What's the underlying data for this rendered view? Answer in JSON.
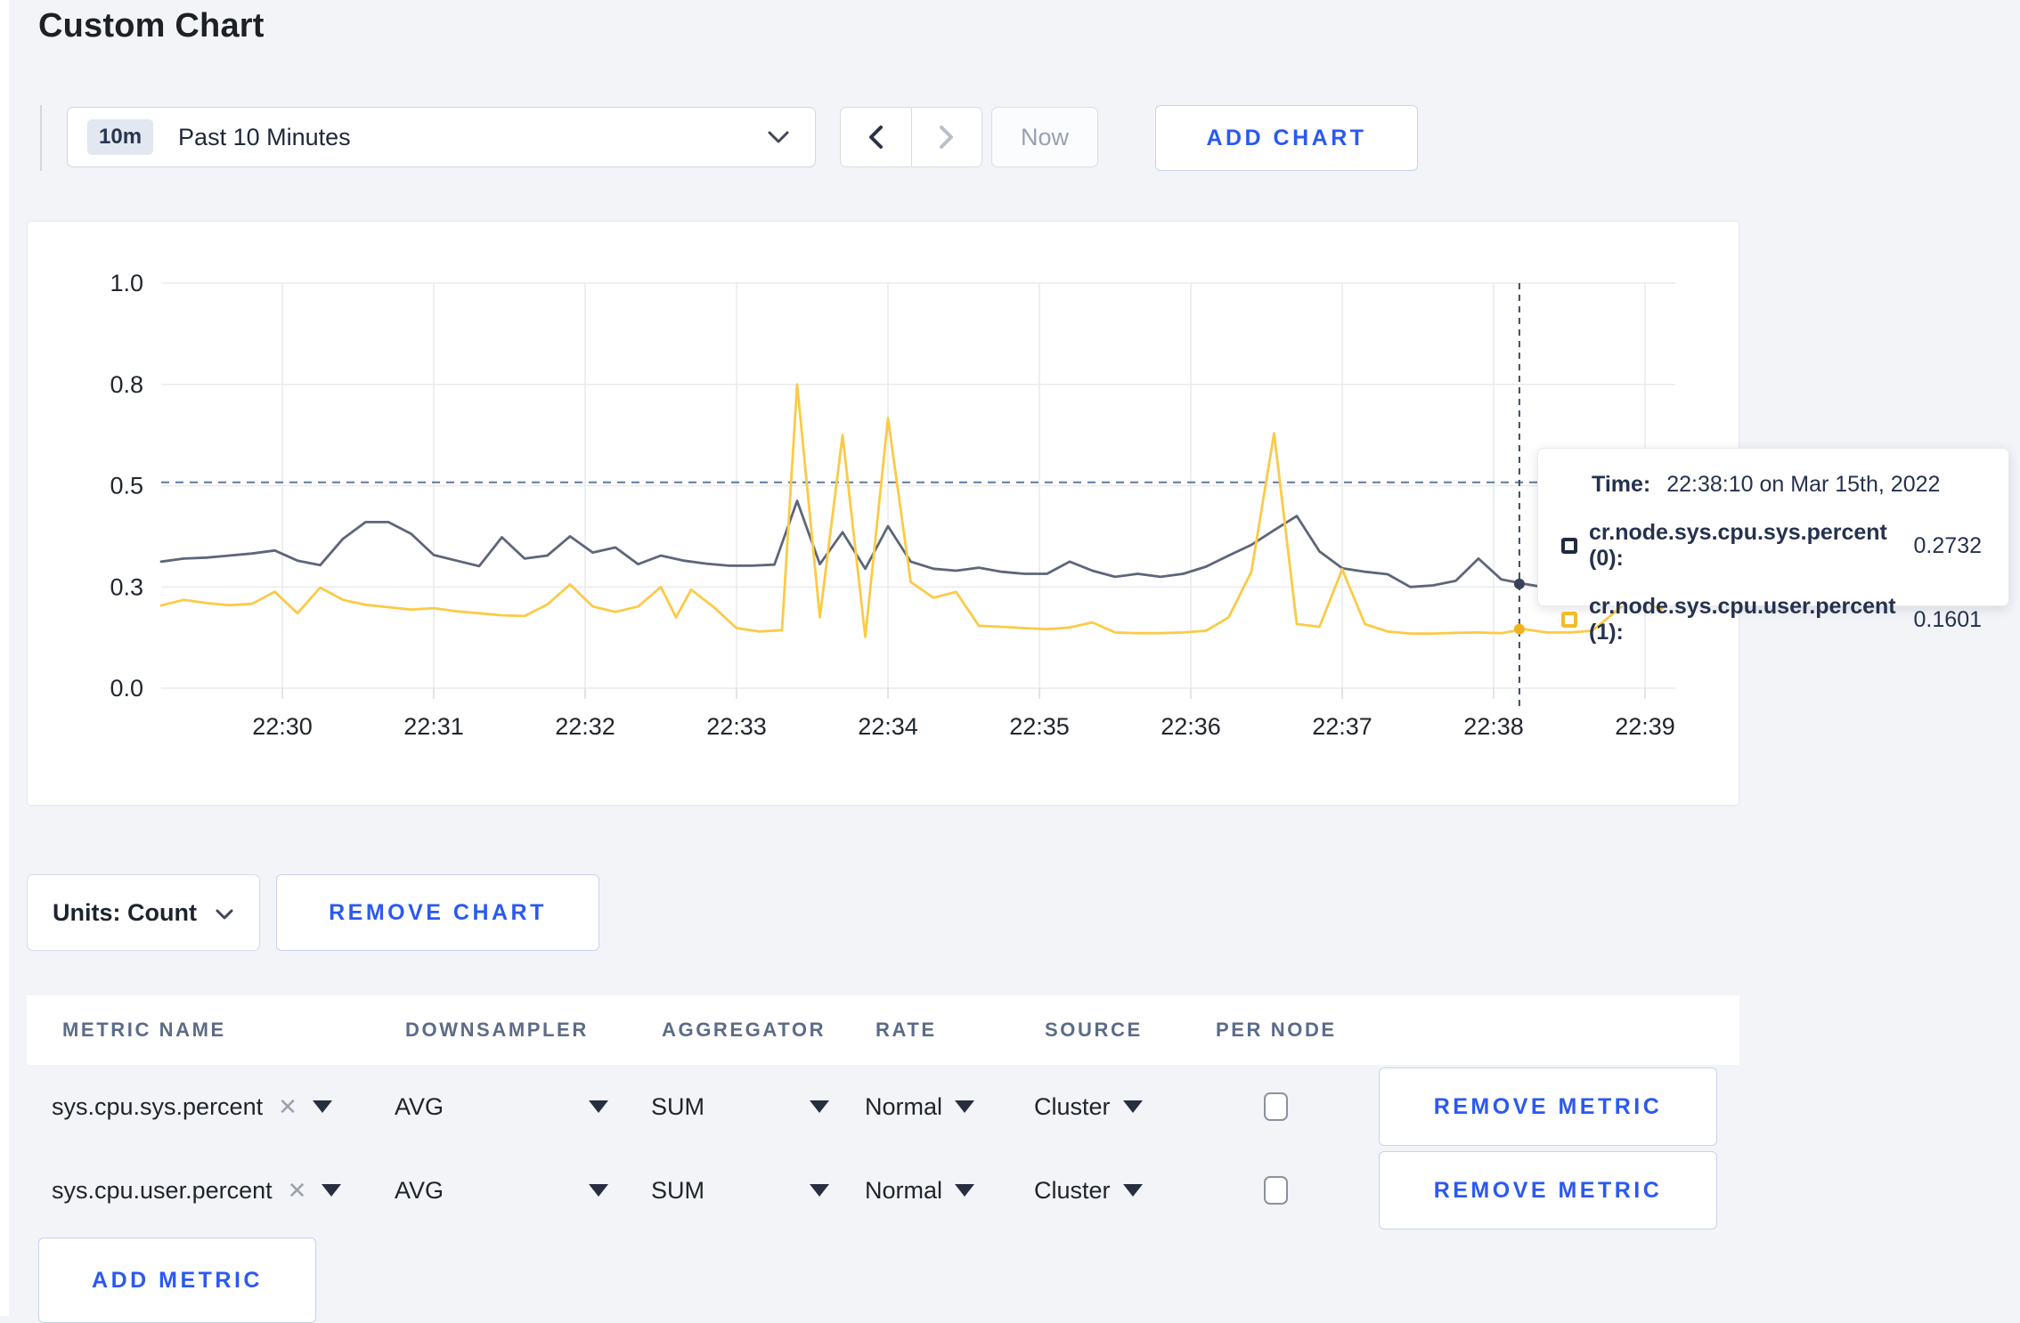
{
  "page": {
    "title": "Custom Chart"
  },
  "toolbar": {
    "time_range": {
      "badge": "10m",
      "label": "Past 10 Minutes"
    },
    "now_label": "Now",
    "add_chart_label": "ADD CHART"
  },
  "icons": {
    "time_dropdown": "chevron-down",
    "prev": "chevron-left",
    "next": "chevron-right",
    "units_dropdown": "chevron-down",
    "metric_remove": "x",
    "select_caret": "triangle-down"
  },
  "tooltip": {
    "time_label": "Time:",
    "time_value": "22:38:10 on Mar 15th, 2022",
    "series": [
      {
        "label": "cr.node.sys.cpu.sys.percent (0):",
        "value": "0.2732",
        "swatch_color": "#1f2940"
      },
      {
        "label": "cr.node.sys.cpu.user.percent (1):",
        "value": "0.1601",
        "swatch_color": "#f1bb2a"
      }
    ]
  },
  "chart_controls": {
    "units_label": "Units: Count",
    "remove_chart_label": "REMOVE CHART"
  },
  "metrics_table": {
    "headers": [
      "METRIC NAME",
      "DOWNSAMPLER",
      "AGGREGATOR",
      "RATE",
      "SOURCE",
      "PER NODE"
    ],
    "rows": [
      {
        "metric_name": "sys.cpu.sys.percent",
        "downsampler": "AVG",
        "aggregator": "SUM",
        "rate": "Normal",
        "source": "Cluster",
        "per_node_checked": false,
        "remove_label": "REMOVE METRIC"
      },
      {
        "metric_name": "sys.cpu.user.percent",
        "downsampler": "AVG",
        "aggregator": "SUM",
        "rate": "Normal",
        "source": "Cluster",
        "per_node_checked": false,
        "remove_label": "REMOVE METRIC"
      }
    ],
    "add_metric_label": "ADD METRIC"
  },
  "chart_data": {
    "type": "line",
    "title": "",
    "xlabel": "",
    "ylabel": "",
    "grid": true,
    "legend_position": "none",
    "y_tick_values": [
      0.0,
      0.3,
      0.5,
      0.8,
      1.0
    ],
    "y_tick_labels": [
      "0.0",
      "0.3",
      "0.5",
      "0.8",
      "1.0"
    ],
    "x_tick_labels": [
      "22:30",
      "22:31",
      "22:32",
      "22:33",
      "22:34",
      "22:35",
      "22:36",
      "22:37",
      "22:38",
      "22:39"
    ],
    "x_unit": "minutes_after_22:30",
    "x_range": [
      -0.8,
      9.2
    ],
    "threshold_line_value": 0.51,
    "crosshair": {
      "x_minute": 8.17,
      "time": "22:38:10"
    },
    "series": [
      {
        "name": "cr.node.sys.cpu.sys.percent",
        "color": "#5d6679",
        "dot_color": "#39415a",
        "points": [
          [
            -0.8,
            0.35
          ],
          [
            -0.65,
            0.356
          ],
          [
            -0.5,
            0.358
          ],
          [
            -0.35,
            0.362
          ],
          [
            -0.2,
            0.366
          ],
          [
            -0.05,
            0.372
          ],
          [
            0.1,
            0.352
          ],
          [
            0.25,
            0.343
          ],
          [
            0.4,
            0.395
          ],
          [
            0.55,
            0.428
          ],
          [
            0.7,
            0.428
          ],
          [
            0.85,
            0.405
          ],
          [
            1.0,
            0.363
          ],
          [
            1.15,
            0.352
          ],
          [
            1.3,
            0.341
          ],
          [
            1.45,
            0.398
          ],
          [
            1.6,
            0.356
          ],
          [
            1.75,
            0.362
          ],
          [
            1.9,
            0.4
          ],
          [
            2.05,
            0.368
          ],
          [
            2.2,
            0.378
          ],
          [
            2.35,
            0.345
          ],
          [
            2.5,
            0.362
          ],
          [
            2.65,
            0.352
          ],
          [
            2.8,
            0.346
          ],
          [
            2.95,
            0.342
          ],
          [
            3.1,
            0.342
          ],
          [
            3.25,
            0.344
          ],
          [
            3.4,
            0.47
          ],
          [
            3.55,
            0.345
          ],
          [
            3.7,
            0.408
          ],
          [
            3.85,
            0.336
          ],
          [
            4.0,
            0.42
          ],
          [
            4.15,
            0.35
          ],
          [
            4.3,
            0.336
          ],
          [
            4.45,
            0.332
          ],
          [
            4.6,
            0.338
          ],
          [
            4.75,
            0.33
          ],
          [
            4.9,
            0.326
          ],
          [
            5.05,
            0.326
          ],
          [
            5.2,
            0.35
          ],
          [
            5.35,
            0.332
          ],
          [
            5.5,
            0.32
          ],
          [
            5.65,
            0.326
          ],
          [
            5.8,
            0.32
          ],
          [
            5.95,
            0.326
          ],
          [
            6.1,
            0.34
          ],
          [
            6.25,
            0.362
          ],
          [
            6.4,
            0.383
          ],
          [
            6.55,
            0.412
          ],
          [
            6.7,
            0.44
          ],
          [
            6.85,
            0.37
          ],
          [
            7.0,
            0.337
          ],
          [
            7.15,
            0.33
          ],
          [
            7.3,
            0.325
          ],
          [
            7.45,
            0.3
          ],
          [
            7.6,
            0.303
          ],
          [
            7.75,
            0.312
          ],
          [
            7.9,
            0.356
          ],
          [
            8.05,
            0.315
          ],
          [
            8.2,
            0.306
          ],
          [
            8.35,
            0.298
          ],
          [
            8.5,
            0.306
          ],
          [
            8.65,
            0.312
          ],
          [
            8.8,
            0.318
          ],
          [
            8.95,
            0.315
          ],
          [
            9.1,
            0.311
          ],
          [
            9.2,
            0.31
          ]
        ]
      },
      {
        "name": "cr.node.sys.cpu.user.percent",
        "color": "#fcca46",
        "dot_color": "#f0b51e",
        "points": [
          [
            -0.8,
            0.245
          ],
          [
            -0.65,
            0.262
          ],
          [
            -0.5,
            0.252
          ],
          [
            -0.35,
            0.246
          ],
          [
            -0.2,
            0.25
          ],
          [
            -0.05,
            0.286
          ],
          [
            0.1,
            0.222
          ],
          [
            0.25,
            0.298
          ],
          [
            0.4,
            0.262
          ],
          [
            0.55,
            0.247
          ],
          [
            0.7,
            0.24
          ],
          [
            0.85,
            0.233
          ],
          [
            1.0,
            0.237
          ],
          [
            1.15,
            0.228
          ],
          [
            1.3,
            0.222
          ],
          [
            1.45,
            0.216
          ],
          [
            1.6,
            0.214
          ],
          [
            1.75,
            0.248
          ],
          [
            1.9,
            0.305
          ],
          [
            2.05,
            0.242
          ],
          [
            2.2,
            0.226
          ],
          [
            2.35,
            0.242
          ],
          [
            2.5,
            0.3
          ],
          [
            2.6,
            0.21
          ],
          [
            2.7,
            0.292
          ],
          [
            2.85,
            0.24
          ],
          [
            3.0,
            0.178
          ],
          [
            3.15,
            0.168
          ],
          [
            3.3,
            0.172
          ],
          [
            3.4,
            0.8
          ],
          [
            3.55,
            0.21
          ],
          [
            3.7,
            0.65
          ],
          [
            3.85,
            0.152
          ],
          [
            4.0,
            0.7
          ],
          [
            4.15,
            0.31
          ],
          [
            4.3,
            0.268
          ],
          [
            4.45,
            0.285
          ],
          [
            4.6,
            0.185
          ],
          [
            4.75,
            0.182
          ],
          [
            4.9,
            0.178
          ],
          [
            5.05,
            0.175
          ],
          [
            5.2,
            0.18
          ],
          [
            5.35,
            0.195
          ],
          [
            5.5,
            0.165
          ],
          [
            5.65,
            0.163
          ],
          [
            5.8,
            0.163
          ],
          [
            5.95,
            0.165
          ],
          [
            6.1,
            0.17
          ],
          [
            6.25,
            0.21
          ],
          [
            6.4,
            0.33
          ],
          [
            6.55,
            0.655
          ],
          [
            6.7,
            0.19
          ],
          [
            6.85,
            0.182
          ],
          [
            7.0,
            0.335
          ],
          [
            7.15,
            0.19
          ],
          [
            7.3,
            0.168
          ],
          [
            7.45,
            0.162
          ],
          [
            7.6,
            0.162
          ],
          [
            7.75,
            0.164
          ],
          [
            7.9,
            0.165
          ],
          [
            8.05,
            0.163
          ],
          [
            8.2,
            0.175
          ],
          [
            8.35,
            0.165
          ],
          [
            8.5,
            0.165
          ],
          [
            8.65,
            0.17
          ],
          [
            8.8,
            0.225
          ],
          [
            8.95,
            0.285
          ],
          [
            9.1,
            0.232
          ],
          [
            9.2,
            0.27
          ]
        ]
      }
    ]
  }
}
